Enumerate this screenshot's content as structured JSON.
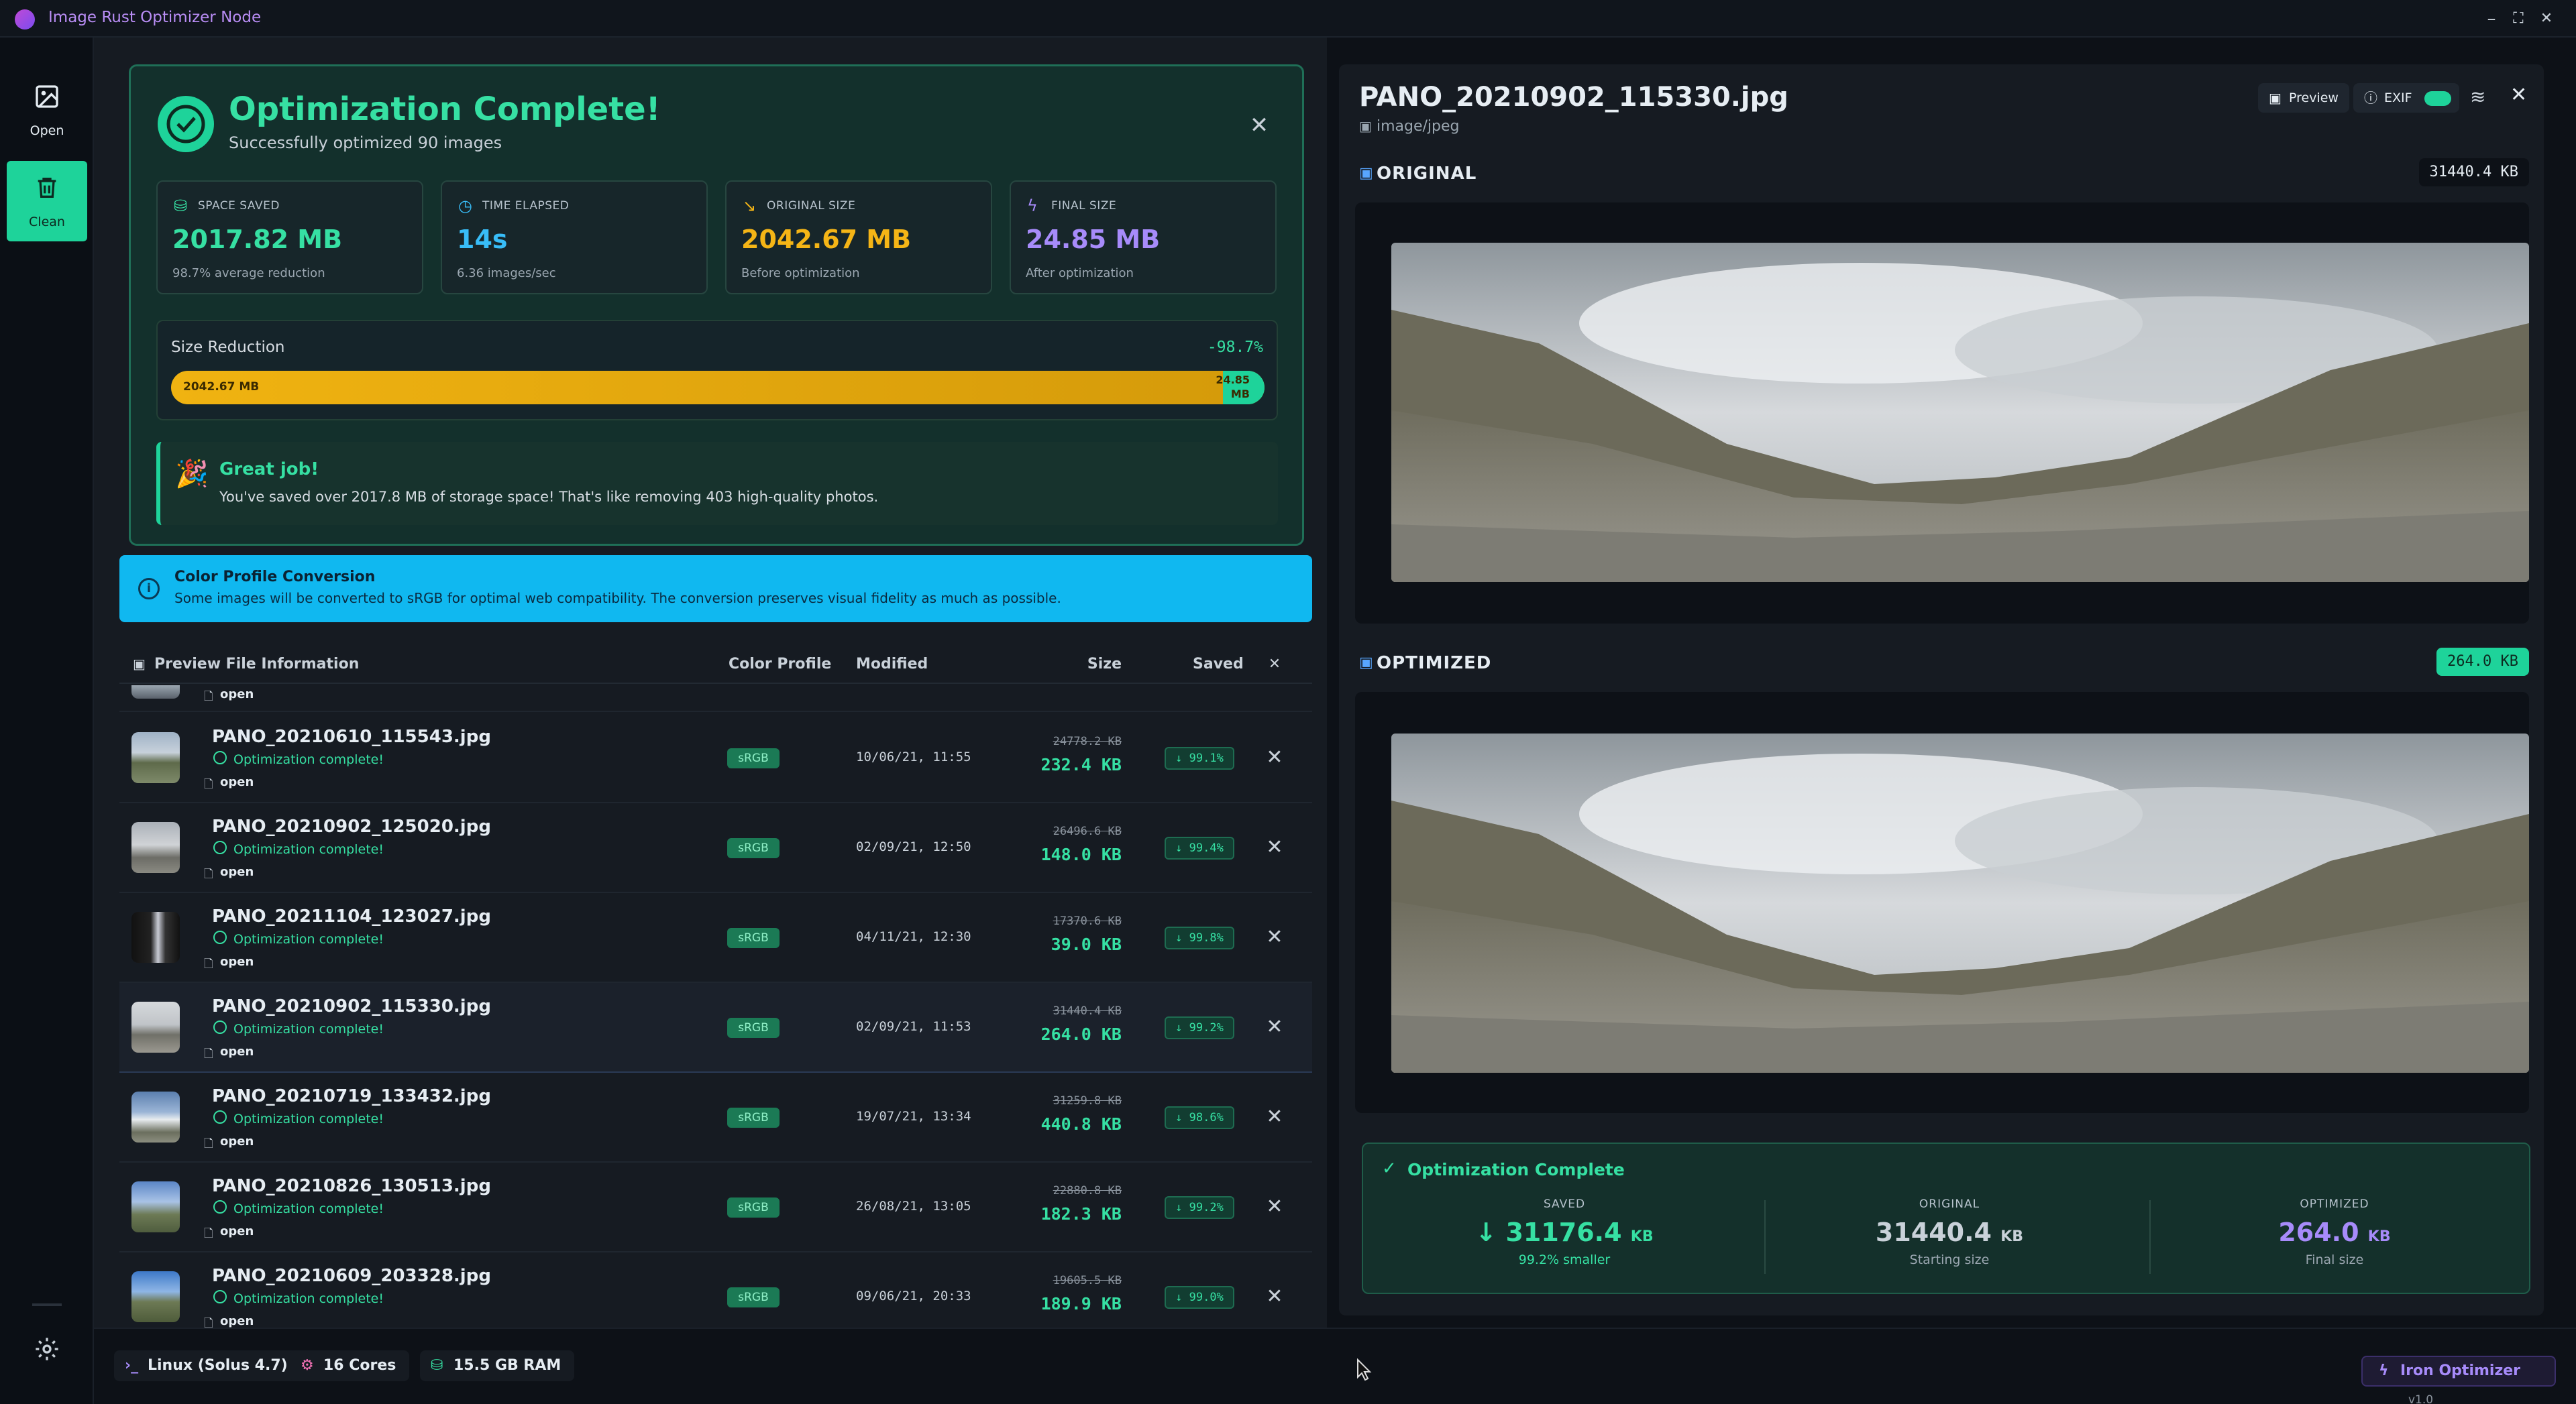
{
  "app": {
    "title": "Image Rust Optimizer Node"
  },
  "window": {
    "minimize": "–",
    "maximize": "⛶",
    "close": "✕"
  },
  "rail": {
    "open_label": "Open",
    "clean_label": "Clean"
  },
  "summary": {
    "title": "Optimization Complete!",
    "subtitle": "Successfully optimized 90 images",
    "cards": [
      {
        "title": "SPACE SAVED",
        "value": "2017.82 MB",
        "sub": "98.7% average reduction",
        "color": "#36e0a3"
      },
      {
        "title": "TIME ELAPSED",
        "value": "14s",
        "sub": "6.36 images/sec",
        "color": "#38bdf8"
      },
      {
        "title": "ORIGINAL SIZE",
        "value": "2042.67 MB",
        "sub": "Before optimization",
        "color": "#f5b516"
      },
      {
        "title": "FINAL SIZE",
        "value": "24.85 MB",
        "sub": "After optimization",
        "color": "#a78bfa"
      }
    ],
    "size_reduction": {
      "label": "Size Reduction",
      "percent": "-98.7%",
      "original": "2042.67 MB",
      "final_line1": "24.85",
      "final_line2": "MB"
    },
    "great_job": {
      "title": "Great job!",
      "text": "You've saved over 2017.8 MB of storage space! That's like removing 403 high-quality photos."
    }
  },
  "banner": {
    "title": "Color Profile Conversion",
    "text": "Some images will be converted to sRGB for optimal web compatibility. The conversion preserves visual fidelity as much as possible."
  },
  "table": {
    "headers": {
      "preview": "Preview File Information",
      "color_profile": "Color Profile",
      "modified": "Modified",
      "size": "Size",
      "saved": "Saved",
      "clear": "✕"
    },
    "open_label": "open",
    "rows": [
      {
        "name": "PANO_20210610_115543.jpg",
        "status": "Optimization complete!",
        "profile": "sRGB",
        "modified": "10/06/21, 11:55",
        "original": "24778.2 KB",
        "size": "232.4 KB",
        "saved": "↓ 99.1%"
      },
      {
        "name": "PANO_20210902_125020.jpg",
        "status": "Optimization complete!",
        "profile": "sRGB",
        "modified": "02/09/21, 12:50",
        "original": "26496.6 KB",
        "size": "148.0 KB",
        "saved": "↓ 99.4%"
      },
      {
        "name": "PANO_20211104_123027.jpg",
        "status": "Optimization complete!",
        "profile": "sRGB",
        "modified": "04/11/21, 12:30",
        "original": "17370.6 KB",
        "size": "39.0 KB",
        "saved": "↓ 99.8%"
      },
      {
        "name": "PANO_20210902_115330.jpg",
        "status": "Optimization complete!",
        "profile": "sRGB",
        "modified": "02/09/21, 11:53",
        "original": "31440.4 KB",
        "size": "264.0 KB",
        "saved": "↓ 99.2%"
      },
      {
        "name": "PANO_20210719_133432.jpg",
        "status": "Optimization complete!",
        "profile": "sRGB",
        "modified": "19/07/21, 13:34",
        "original": "31259.8 KB",
        "size": "440.8 KB",
        "saved": "↓ 98.6%"
      },
      {
        "name": "PANO_20210826_130513.jpg",
        "status": "Optimization complete!",
        "profile": "sRGB",
        "modified": "26/08/21, 13:05",
        "original": "22880.8 KB",
        "size": "182.3 KB",
        "saved": "↓ 99.2%"
      },
      {
        "name": "PANO_20210609_203328.jpg",
        "status": "Optimization complete!",
        "profile": "sRGB",
        "modified": "09/06/21, 20:33",
        "original": "19605.5 KB",
        "size": "189.9 KB",
        "saved": "↓ 99.0%"
      }
    ]
  },
  "status_bar": {
    "os": "Linux (Solus 4.7)",
    "cores": "16 Cores",
    "ram": "15.5 GB RAM",
    "brand": "Iron Optimizer",
    "version": "v1.0"
  },
  "preview": {
    "filename": "PANO_20210902_115330.jpg",
    "mime": "image/jpeg",
    "preview_btn": "Preview",
    "exif_btn": "EXIF",
    "original_label": "ORIGINAL",
    "original_size": "31440.4 KB",
    "optimized_label": "OPTIMIZED",
    "optimized_size": "264.0 KB",
    "complete": {
      "title": "Optimization Complete",
      "saved_label": "SAVED",
      "saved_value": "↓ 31176.4",
      "saved_unit": "KB",
      "saved_sub": "99.2% smaller",
      "original_label": "ORIGINAL",
      "original_value": "31440.4",
      "original_unit": "KB",
      "original_sub": "Starting size",
      "optimized_label": "OPTIMIZED",
      "optimized_value": "264.0",
      "optimized_unit": "KB",
      "optimized_sub": "Final size"
    }
  }
}
